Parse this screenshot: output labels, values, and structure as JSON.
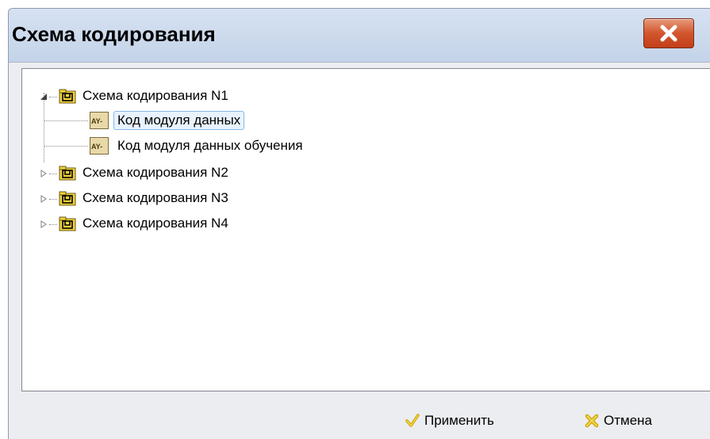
{
  "dialog": {
    "title": "Схема кодирования",
    "close_icon": "close-icon"
  },
  "tree": {
    "nodes": [
      {
        "label": "Схема кодирования N1",
        "expanded": true,
        "icon": "folder-icon",
        "children": [
          {
            "label": "Код модуля данных",
            "icon": "module-code-icon",
            "selected": true
          },
          {
            "label": "Код модуля данных обучения",
            "icon": "module-code-icon",
            "selected": false
          }
        ]
      },
      {
        "label": "Схема кодирования N2",
        "expanded": false,
        "icon": "folder-icon"
      },
      {
        "label": "Схема кодирования N3",
        "expanded": false,
        "icon": "folder-icon"
      },
      {
        "label": "Схема кодирования N4",
        "expanded": false,
        "icon": "folder-icon"
      }
    ]
  },
  "footer": {
    "apply_label": "Применить",
    "cancel_label": "Отмена"
  },
  "colors": {
    "titlebar": "#c9d7ea",
    "close_button": "#d2552d",
    "folder": "#f1d23a",
    "selection_border": "#86b7e8"
  }
}
